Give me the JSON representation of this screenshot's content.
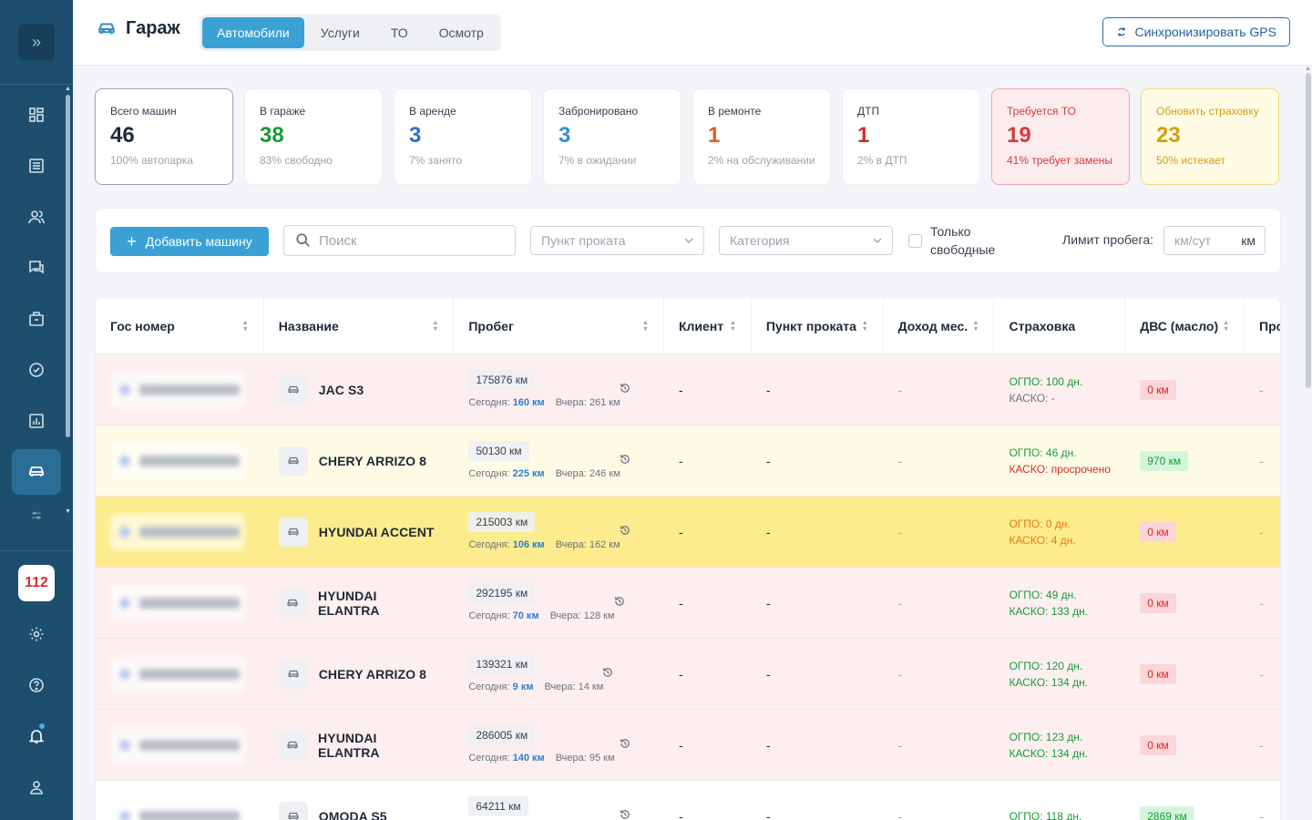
{
  "sidebar": {
    "toggle_icon": "chevrons-right-icon",
    "nav": [
      "dashboard-icon",
      "list-icon",
      "users-icon",
      "chat-icon",
      "briefcase-icon",
      "check-circle-icon",
      "chart-icon",
      "car-icon"
    ],
    "active": "car-icon",
    "badge": "112"
  },
  "header": {
    "title": "Гараж",
    "tabs": [
      "Автомобили",
      "Услуги",
      "ТО",
      "Осмотр"
    ],
    "active_tab": 0,
    "sync_label": "Синхронизировать GPS"
  },
  "stats": [
    {
      "label": "Всего машин",
      "value": "46",
      "sub": "100% автопарка",
      "color": "#1f2937"
    },
    {
      "label": "В гараже",
      "value": "38",
      "sub": "83% свободно",
      "color": "#1a9b3a"
    },
    {
      "label": "В аренде",
      "value": "3",
      "sub": "7% занято",
      "color": "#2f6fd0"
    },
    {
      "label": "Забронировано",
      "value": "3",
      "sub": "7% в ожидании",
      "color": "#2f8fd0"
    },
    {
      "label": "В ремонте",
      "value": "1",
      "sub": "2% на обслуживании",
      "color": "#e0611a"
    },
    {
      "label": "ДТП",
      "value": "1",
      "sub": "2% в ДТП",
      "color": "#d62b2b"
    },
    {
      "label": "Требуется ТО",
      "value": "19",
      "sub": "41% требует замены",
      "color": "#d83a3a"
    },
    {
      "label": "Обновить страховку",
      "value": "23",
      "sub": "50% истекает",
      "color": "#d49f0f"
    }
  ],
  "filters": {
    "add_label": "Добавить машину",
    "search_placeholder": "Поиск",
    "point_placeholder": "Пункт проката",
    "category_placeholder": "Категория",
    "free_only_line1": "Только",
    "free_only_line2": "свободные",
    "limit_label": "Лимит пробега:",
    "limit_placeholder": "км/сут",
    "limit_unit": "км"
  },
  "table": {
    "columns": [
      "Гос номер",
      "Название",
      "Пробег",
      "Клиент",
      "Пункт проката",
      "Доход мес.",
      "Страховка",
      "ДВС (масло)",
      "Про"
    ],
    "rows": [
      {
        "bg": "pink",
        "name": "JAC S3",
        "mileage": "175876 км",
        "today": "160 км",
        "yesterday": "261 км",
        "client": "-",
        "point": "-",
        "income": "-",
        "osago": "ОГПО: 100 дн.",
        "osago_c": "g",
        "kasko": "КАСКО: -",
        "kasko_c": "gr",
        "oil": "0 км",
        "oil_ok": false,
        "last": "-"
      },
      {
        "bg": "cream",
        "name": "CHERY ARRIZO 8",
        "mileage": "50130 км",
        "today": "225 км",
        "yesterday": "246 км",
        "client": "-",
        "point": "-",
        "income": "-",
        "osago": "ОГПО: 46 дн.",
        "osago_c": "g",
        "kasko": "КАСКО: просрочено",
        "kasko_c": "r",
        "oil": "970 км",
        "oil_ok": true,
        "last": "-"
      },
      {
        "bg": "yellow",
        "name": "HYUNDAI ACCENT",
        "mileage": "215003 км",
        "today": "106 км",
        "yesterday": "162 км",
        "client": "-",
        "point": "-",
        "income": "-",
        "osago": "ОГПО: 0 дн.",
        "osago_c": "o",
        "kasko": "КАСКО: 4 дн.",
        "kasko_c": "o",
        "oil": "0 км",
        "oil_ok": false,
        "last": "-"
      },
      {
        "bg": "pink",
        "name": "HYUNDAI ELANTRA",
        "mileage": "292195 км",
        "today": "70 км",
        "yesterday": "128 км",
        "client": "-",
        "point": "-",
        "income": "-",
        "osago": "ОГПО: 49 дн.",
        "osago_c": "g",
        "kasko": "КАСКО: 133 дн.",
        "kasko_c": "g",
        "oil": "0 км",
        "oil_ok": false,
        "last": "-"
      },
      {
        "bg": "pink",
        "name": "CHERY ARRIZO 8",
        "mileage": "139321 км",
        "today": "9 км",
        "yesterday": "14 км",
        "client": "-",
        "point": "-",
        "income": "-",
        "osago": "ОГПО: 120 дн.",
        "osago_c": "g",
        "kasko": "КАСКО: 134 дн.",
        "kasko_c": "g",
        "oil": "0 км",
        "oil_ok": false,
        "last": "-"
      },
      {
        "bg": "pink",
        "name": "HYUNDAI ELANTRA",
        "mileage": "286005 км",
        "today": "140 км",
        "yesterday": "95 км",
        "client": "-",
        "point": "-",
        "income": "-",
        "osago": "ОГПО: 123 дн.",
        "osago_c": "g",
        "kasko": "КАСКО: 134 дн.",
        "kasko_c": "g",
        "oil": "0 км",
        "oil_ok": false,
        "last": "-"
      },
      {
        "bg": "white",
        "name": "OMODA S5",
        "mileage": "64211 км",
        "today": "",
        "yesterday": "",
        "client": "-",
        "point": "-",
        "income": "-",
        "osago": "ОГПО: 118 дн.",
        "osago_c": "g",
        "kasko": "",
        "kasko_c": "g",
        "oil": "2869 км",
        "oil_ok": true,
        "last": "-"
      }
    ],
    "today_label": "Сегодня: ",
    "yesterday_label": "Вчера: "
  }
}
